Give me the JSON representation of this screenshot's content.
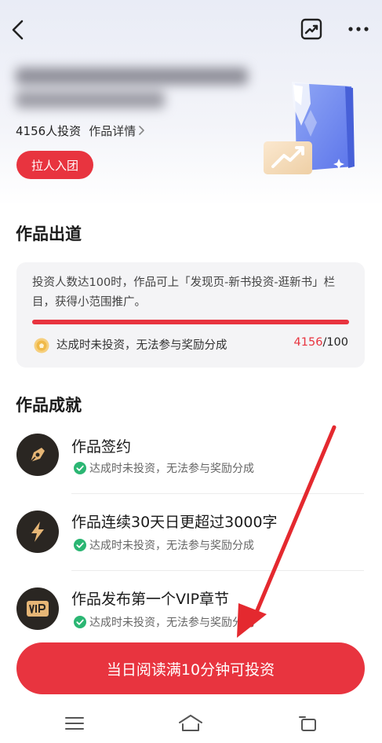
{
  "header": {
    "back_icon": "back-chevron-icon",
    "trend_icon": "trend-chart-icon",
    "more_icon": "more-dots-icon"
  },
  "work": {
    "investor_count": "4156人投资",
    "detail_link": "作品详情",
    "join_button": "拉人入团"
  },
  "debut": {
    "section_title": "作品出道",
    "description": "投资人数达100时，作品可上「发现页-新书投资-逛新书」栏目，获得小范围推广。",
    "note": "达成时未投资，无法参与奖励分成",
    "current": "4156",
    "target": "/100",
    "progress_fraction": 1.0
  },
  "achievements": {
    "section_title": "作品成就",
    "items": [
      {
        "title": "作品签约",
        "status": "达成时未投资，无法参与奖励分成",
        "icon": "pen-nib-icon"
      },
      {
        "title": "作品连续30天日更超过3000字",
        "status": "达成时未投资，无法参与奖励分成",
        "icon": "lightning-icon"
      },
      {
        "title": "作品发布第一个VIP章节",
        "status": "达成时未投资，无法参与奖励分成",
        "icon": "vip-badge-icon"
      }
    ]
  },
  "cta": {
    "label": "当日阅读满10分钟可投资"
  },
  "colors": {
    "accent": "#e8343f",
    "check": "#2bb673",
    "icon_bg": "#2a2622",
    "icon_gold": "#e6b676"
  }
}
